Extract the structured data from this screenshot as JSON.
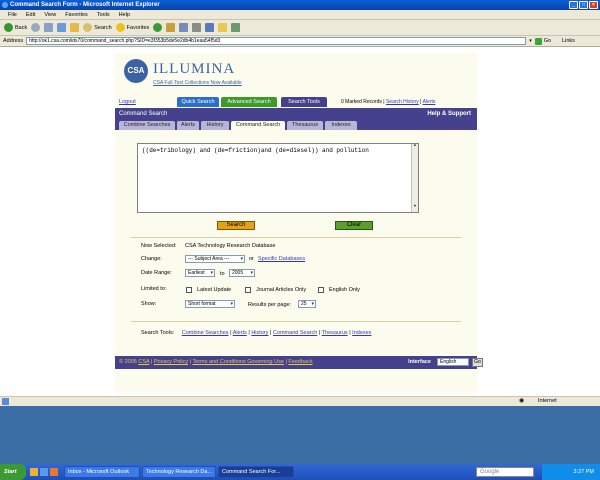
{
  "window": {
    "title": "Command Search Form - Microsoft Internet Explorer"
  },
  "menu": [
    "File",
    "Edit",
    "View",
    "Favorites",
    "Tools",
    "Help"
  ],
  "toolbar": {
    "back": "Back",
    "search": "Search",
    "favorites": "Favorites"
  },
  "address": {
    "label": "Address",
    "url": "http://ok1.csa.com/ids70/command_search.php?SID=e3f353b5de5e2db4b1eaa54f5d3",
    "go": "Go",
    "links": "Links"
  },
  "header": {
    "logo": "CSA",
    "brand": "ILLUMINA",
    "promo": "CSA Full-Text Collections Now Available",
    "logout": "Logout",
    "quick_search": "Quick Search",
    "advanced_search": "Advanced Search",
    "search_tools": "Search Tools",
    "marked": "0 Marked Records",
    "search_history": "Search History",
    "alerts": "Alerts",
    "sep": "|"
  },
  "panel": {
    "title": "Command Search",
    "help": "Help & Support"
  },
  "tabs": [
    "Combine Searches",
    "Alerts",
    "History",
    "Command Search",
    "Thesaurus",
    "Indexes"
  ],
  "query": "((de=tribology) and (de=friction)and (de=diesel)) and pollution",
  "buttons": {
    "search": "Search",
    "clear": "Clear"
  },
  "form": {
    "now_selected_label": "Now Selected:",
    "now_selected_value": "CSA Technology Research Database",
    "change_label": "Change:",
    "subject_area": "--- Subject Area ---",
    "or": "or",
    "specific_databases": "Specific Databases",
    "date_range_label": "Date Range:",
    "date_from": "Earliest",
    "to": "to",
    "date_to": "2005",
    "limited_label": "Limited to:",
    "latest_update": "Latest Update",
    "journal_articles": "Journal Articles Only",
    "english_only": "English Only",
    "show_label": "Show:",
    "show_value": "Short format",
    "results_label": "Results per page:",
    "results_value": "25"
  },
  "search_tools": {
    "label": "Search Tools:",
    "links": [
      "Combine Searches",
      "Alerts",
      "History",
      "Command Search",
      "Thesaurus",
      "Indexes"
    ]
  },
  "footer": {
    "copyright": "© 2005",
    "csa": "CSA",
    "privacy": "Privacy Policy",
    "terms": "Terms and Conditions Governing Use",
    "feedback": "Feedback",
    "interface_label": "Interface",
    "interface_value": "English",
    "go": "Go"
  },
  "status": {
    "zone": "Internet"
  },
  "taskbar": {
    "start": "Start",
    "tasks": [
      "Inbox - Microsoft Outlook",
      "Technology Research Da...",
      "Command Search For..."
    ],
    "clock": "3:27 PM",
    "google": "Google"
  },
  "colors": {
    "nav_purple": "#46418c",
    "search_orange": "#e8a01a",
    "clear_green": "#5aa02a",
    "quick_blue": "#2a6fc8",
    "advanced_green": "#3a9a2a",
    "tools_purple": "#46418c"
  }
}
